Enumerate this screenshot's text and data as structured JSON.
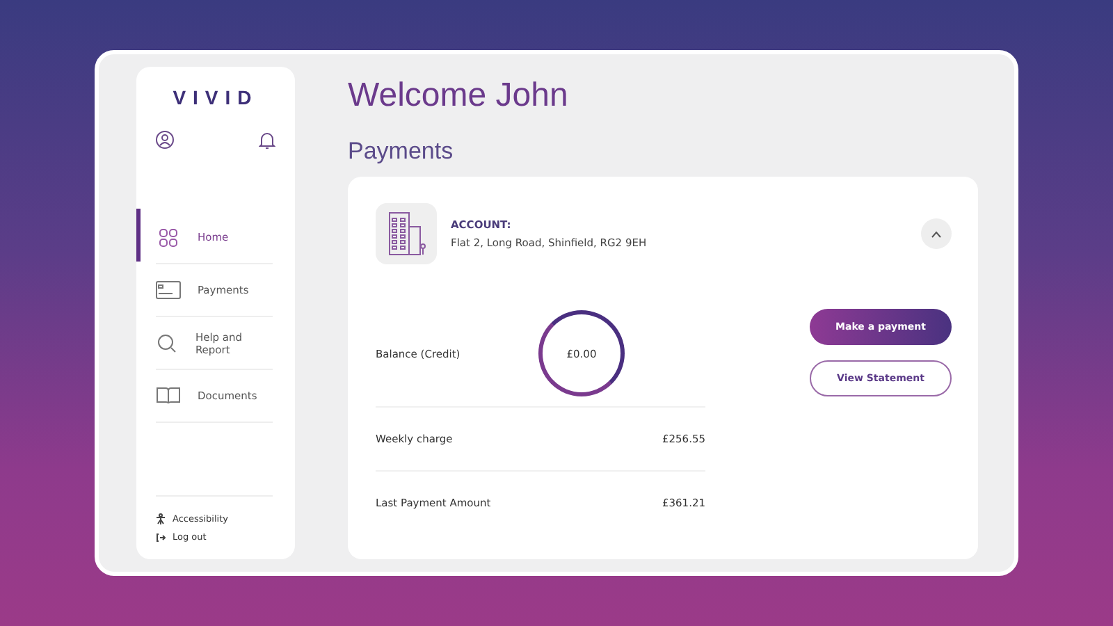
{
  "logo": "VIVID",
  "nav": [
    {
      "label": "Home",
      "kind": "grid",
      "selected": true
    },
    {
      "label": "Payments",
      "kind": "card",
      "selected": false
    },
    {
      "label": "Help and Report",
      "kind": "search",
      "selected": false
    },
    {
      "label": "Documents",
      "kind": "book",
      "selected": false
    }
  ],
  "footer_links": [
    {
      "label": "Accessibility",
      "kind": "person"
    },
    {
      "label": "Log out",
      "kind": "logout"
    }
  ],
  "heading": "Welcome John",
  "section_title": "Payments",
  "account": {
    "label": "ACCOUNT:",
    "address": "Flat 2, Long Road, Shinfield, RG2 9EH",
    "expanded": true
  },
  "rows": [
    {
      "label": "Balance (Credit)",
      "value": "£0.00",
      "kind": "ring"
    },
    {
      "label": "Weekly charge",
      "value": "£256.55",
      "kind": "plain"
    },
    {
      "label": "Last Payment Amount",
      "value": "£361.21",
      "kind": "plain"
    }
  ],
  "buttons": [
    {
      "label": "Make a payment",
      "kind": "primary"
    },
    {
      "label": "View Statement",
      "kind": "outline"
    }
  ]
}
